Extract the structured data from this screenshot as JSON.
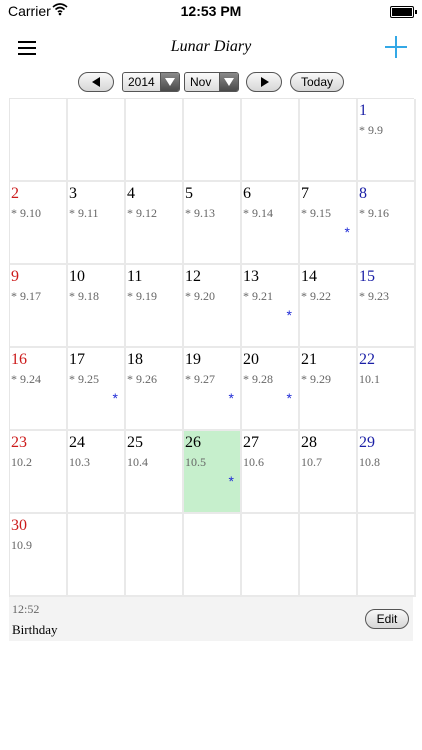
{
  "status_bar": {
    "carrier": "Carrier",
    "time": "12:53 PM"
  },
  "nav": {
    "title": "Lunar Diary"
  },
  "toolbar": {
    "year": "2014",
    "month": "Nov",
    "today_label": "Today"
  },
  "colors": {
    "sunday": "#cc1a1a",
    "saturday": "#1a1fa6",
    "weekday": "#000000",
    "selected": "#c6efcc",
    "accent": "#33a8e6",
    "marker": "#1f2bd6"
  },
  "calendar": {
    "weeks": [
      [
        {
          "day": "",
          "lunar": "",
          "dow": 0
        },
        {
          "day": "",
          "lunar": "",
          "dow": 1
        },
        {
          "day": "",
          "lunar": "",
          "dow": 2
        },
        {
          "day": "",
          "lunar": "",
          "dow": 3
        },
        {
          "day": "",
          "lunar": "",
          "dow": 4
        },
        {
          "day": "",
          "lunar": "",
          "dow": 5
        },
        {
          "day": "1",
          "lunar": "* 9.9",
          "dow": 6
        }
      ],
      [
        {
          "day": "2",
          "lunar": "* 9.10",
          "dow": 0
        },
        {
          "day": "3",
          "lunar": "* 9.11",
          "dow": 1
        },
        {
          "day": "4",
          "lunar": "* 9.12",
          "dow": 2
        },
        {
          "day": "5",
          "lunar": "* 9.13",
          "dow": 3
        },
        {
          "day": "6",
          "lunar": "* 9.14",
          "dow": 4
        },
        {
          "day": "7",
          "lunar": "* 9.15",
          "dow": 5,
          "marker": "*"
        },
        {
          "day": "8",
          "lunar": "* 9.16",
          "dow": 6
        }
      ],
      [
        {
          "day": "9",
          "lunar": "* 9.17",
          "dow": 0
        },
        {
          "day": "10",
          "lunar": "* 9.18",
          "dow": 1
        },
        {
          "day": "11",
          "lunar": "* 9.19",
          "dow": 2
        },
        {
          "day": "12",
          "lunar": "* 9.20",
          "dow": 3
        },
        {
          "day": "13",
          "lunar": "* 9.21",
          "dow": 4,
          "marker": "*"
        },
        {
          "day": "14",
          "lunar": "* 9.22",
          "dow": 5
        },
        {
          "day": "15",
          "lunar": "* 9.23",
          "dow": 6
        }
      ],
      [
        {
          "day": "16",
          "lunar": "* 9.24",
          "dow": 0
        },
        {
          "day": "17",
          "lunar": "* 9.25",
          "dow": 1,
          "marker": "*"
        },
        {
          "day": "18",
          "lunar": "* 9.26",
          "dow": 2
        },
        {
          "day": "19",
          "lunar": "* 9.27",
          "dow": 3,
          "marker": "*"
        },
        {
          "day": "20",
          "lunar": "* 9.28",
          "dow": 4,
          "marker": "*"
        },
        {
          "day": "21",
          "lunar": "* 9.29",
          "dow": 5
        },
        {
          "day": "22",
          "lunar": "10.1",
          "dow": 6
        }
      ],
      [
        {
          "day": "23",
          "lunar": "10.2",
          "dow": 0
        },
        {
          "day": "24",
          "lunar": "10.3",
          "dow": 1
        },
        {
          "day": "25",
          "lunar": "10.4",
          "dow": 2
        },
        {
          "day": "26",
          "lunar": "10.5",
          "dow": 3,
          "marker": "*",
          "selected": true
        },
        {
          "day": "27",
          "lunar": "10.6",
          "dow": 4
        },
        {
          "day": "28",
          "lunar": "10.7",
          "dow": 5
        },
        {
          "day": "29",
          "lunar": "10.8",
          "dow": 6
        }
      ],
      [
        {
          "day": "30",
          "lunar": "10.9",
          "dow": 0
        },
        {
          "day": "",
          "lunar": "",
          "dow": 1
        },
        {
          "day": "",
          "lunar": "",
          "dow": 2
        },
        {
          "day": "",
          "lunar": "",
          "dow": 3
        },
        {
          "day": "",
          "lunar": "",
          "dow": 4
        },
        {
          "day": "",
          "lunar": "",
          "dow": 5
        },
        {
          "day": "",
          "lunar": "",
          "dow": 6
        }
      ]
    ]
  },
  "detail": {
    "time": "12:52",
    "title": "Birthday",
    "edit_label": "Edit"
  }
}
